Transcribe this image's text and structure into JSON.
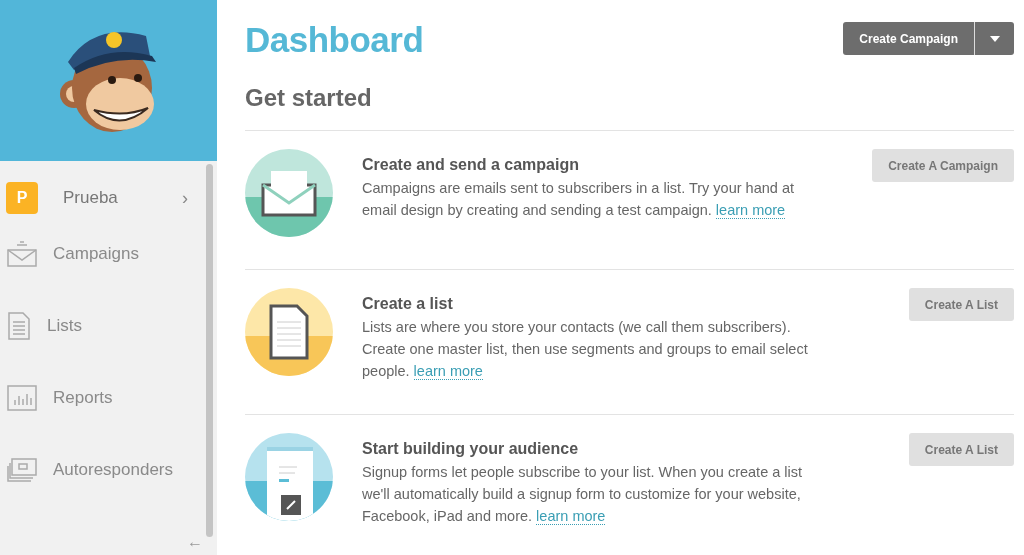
{
  "sidebar": {
    "account": {
      "initial": "P",
      "name": "Prueba",
      "chevron": "›"
    },
    "items": [
      {
        "label": "Campaigns",
        "kind": "campaigns"
      },
      {
        "label": "Lists",
        "kind": "lists"
      },
      {
        "label": "Reports",
        "kind": "reports"
      },
      {
        "label": "Autoresponders",
        "kind": "autoresponders"
      }
    ],
    "collapse": "←"
  },
  "header": {
    "title": "Dashboard",
    "button": "Create Campaign"
  },
  "section_title": "Get started",
  "cards": [
    {
      "kind": "campaign",
      "title": "Create and send a campaign",
      "text": "Campaigns are emails sent to subscribers in a list. Try your hand at email design by creating and sending a test campaign.",
      "link": "learn more",
      "button": "Create A Campaign"
    },
    {
      "kind": "list",
      "title": "Create a list",
      "text": "Lists are where you store your contacts (we call them subscribers). Create one master list, then use segments and groups to email select people.",
      "link": "learn more",
      "button": "Create A List"
    },
    {
      "kind": "audience",
      "title": "Start building your audience",
      "text": "Signup forms let people subscribe to your list. When you create a list we'll automatically build a signup form to customize for your website, Facebook, iPad and more.",
      "link": "learn more",
      "button": "Create A List"
    }
  ]
}
